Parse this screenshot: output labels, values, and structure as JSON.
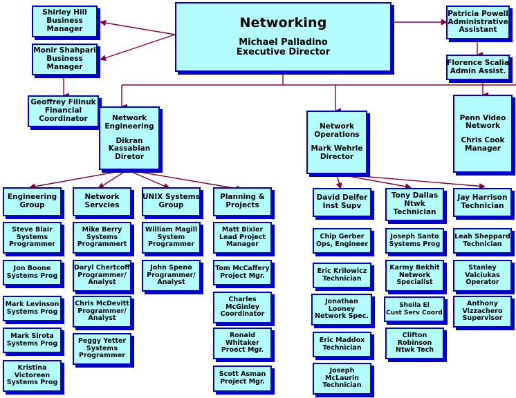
{
  "chart_title": "Networking",
  "colors": {
    "node_fill": "#b3fdff",
    "node_border": "#0000cc",
    "node_shadow": "#0000cc",
    "edge": "#800040",
    "page_background": "#ffffff",
    "text": "#000000"
  },
  "root": {
    "title": "Networking",
    "name": "Michael Palladino",
    "role": "Executive Director"
  },
  "assistants_left": [
    {
      "name": "Shirley Hill",
      "role1": "Business",
      "role2": "Manager"
    },
    {
      "name": "Monir Shahpari",
      "role1": "Business",
      "role2": "Manager"
    },
    {
      "name": "Geoffrey Filinuk",
      "role1": "Financial",
      "role2": "Coordinator"
    }
  ],
  "assistants_right": [
    {
      "name": "Patricia Powell",
      "role1": "Administrative",
      "role2": "Assistant"
    },
    {
      "name": "Florence Scalia",
      "role1": "Admin Assist.",
      "role2": ""
    }
  ],
  "divisions": [
    {
      "id": "network-engineering",
      "title1": "Network",
      "title2": "Engineering",
      "name": "Dikran",
      "name2": "Kassabian",
      "role": "Diretor"
    },
    {
      "id": "network-operations",
      "title1": "Network",
      "title2": "Operations",
      "name": "Mark Wehrle",
      "name2": "",
      "role": "Director"
    },
    {
      "id": "penn-video-network",
      "title1": "Penn Video",
      "title2": "Network",
      "name": "Chris Cook",
      "name2": "",
      "role": "Manager"
    }
  ],
  "groups": [
    {
      "id": "engineering-group",
      "line1": "Engineering",
      "line2": "Group"
    },
    {
      "id": "network-servcies",
      "line1": "Network",
      "line2": "Servcies"
    },
    {
      "id": "unix-systems-group",
      "line1": "UNIX Systems",
      "line2": "Group"
    },
    {
      "id": "planning-projects",
      "line1": "Planning &",
      "line2": "Projects"
    }
  ],
  "ops_leads": [
    {
      "id": "david-deifer",
      "line1": "David Deifer",
      "line2": "Inst Supv",
      "line3": ""
    },
    {
      "id": "tony-dallas",
      "line1": "Tony Dallas",
      "line2": "Ntwk",
      "line3": "Technician"
    },
    {
      "id": "jay-harrison",
      "line1": "Jay Harrison",
      "line2": "Technician",
      "line3": ""
    }
  ],
  "columns": [
    {
      "id": "engineering-group-staff",
      "members": [
        {
          "line1": "Steve Blair",
          "line2": "Systems",
          "line3": "Programmer"
        },
        {
          "line1": "Jon Boone",
          "line2": "Systems Prog",
          "line3": ""
        },
        {
          "line1": "Mark Levinson",
          "line2": "Systems Prog",
          "line3": ""
        },
        {
          "line1": "Mark Sirota",
          "line2": "Systems Prog",
          "line3": ""
        },
        {
          "line1": "Kristina",
          "line2": "Victoreen",
          "line3": "Systems Prog"
        }
      ]
    },
    {
      "id": "network-servcies-staff",
      "members": [
        {
          "line1": "Mike Berry",
          "line2": "Systems",
          "line3": "Programmert"
        },
        {
          "line1": "Daryl Chertcoff",
          "line2": "Programmer/",
          "line3": "Analyst"
        },
        {
          "line1": "Chris McDevitt",
          "line2": "Programmer/",
          "line3": "Analyst"
        },
        {
          "line1": "Peggy Yetter",
          "line2": "Systems",
          "line3": "Programmer"
        }
      ]
    },
    {
      "id": "unix-systems-group-staff",
      "members": [
        {
          "line1": "William Magill",
          "line2": "System",
          "line3": "Programmer"
        },
        {
          "line1": "John Speno",
          "line2": "Programmer/",
          "line3": "Analyst"
        }
      ]
    },
    {
      "id": "planning-projects-staff",
      "members": [
        {
          "line1": "Matt Bixler",
          "line2": "Lead Project",
          "line3": "Manager"
        },
        {
          "line1": "Tom McCaffery",
          "line2": "Project Mgr.",
          "line3": ""
        },
        {
          "line1": "Charles",
          "line2": "McGinley",
          "line3": "Coordinator"
        },
        {
          "line1": "Ronald",
          "line2": "Whitaker",
          "line3": "Proect Mgr."
        },
        {
          "line1": "Scott Asman",
          "line2": "Project Mgr.",
          "line3": ""
        }
      ]
    },
    {
      "id": "david-deifer-staff",
      "members": [
        {
          "line1": "Chip Gerber",
          "line2": "Ops, Engineer",
          "line3": ""
        },
        {
          "line1": "Eric Krilowicz",
          "line2": "Technician",
          "line3": ""
        },
        {
          "line1": "Jonathan",
          "line2": "Looney",
          "line3": "Network Spec."
        },
        {
          "line1": "Eric Maddox",
          "line2": "Technician",
          "line3": ""
        },
        {
          "line1": "Joseph",
          "line2": "McLaurin",
          "line3": "Technician"
        }
      ]
    },
    {
      "id": "tony-dallas-staff",
      "members": [
        {
          "line1": "Joseph Santo",
          "line2": "Systems Prog",
          "line3": ""
        },
        {
          "line1": "Karmy Bekhit",
          "line2": "Network",
          "line3": "Specialist"
        },
        {
          "line1": "Sheila El",
          "line2": "Cust Serv Coord",
          "line3": ""
        },
        {
          "line1": "Clifton",
          "line2": "Robinson",
          "line3": "Ntwk Tech"
        }
      ]
    },
    {
      "id": "jay-harrison-staff",
      "members": [
        {
          "line1": "Leah Sheppard",
          "line2": "Technician",
          "line3": ""
        },
        {
          "line1": "Stanley",
          "line2": "Valciukas",
          "line3": "Operator"
        },
        {
          "line1": "Anthony",
          "line2": "Vizzachero",
          "line3": "Supervisor"
        }
      ]
    }
  ]
}
